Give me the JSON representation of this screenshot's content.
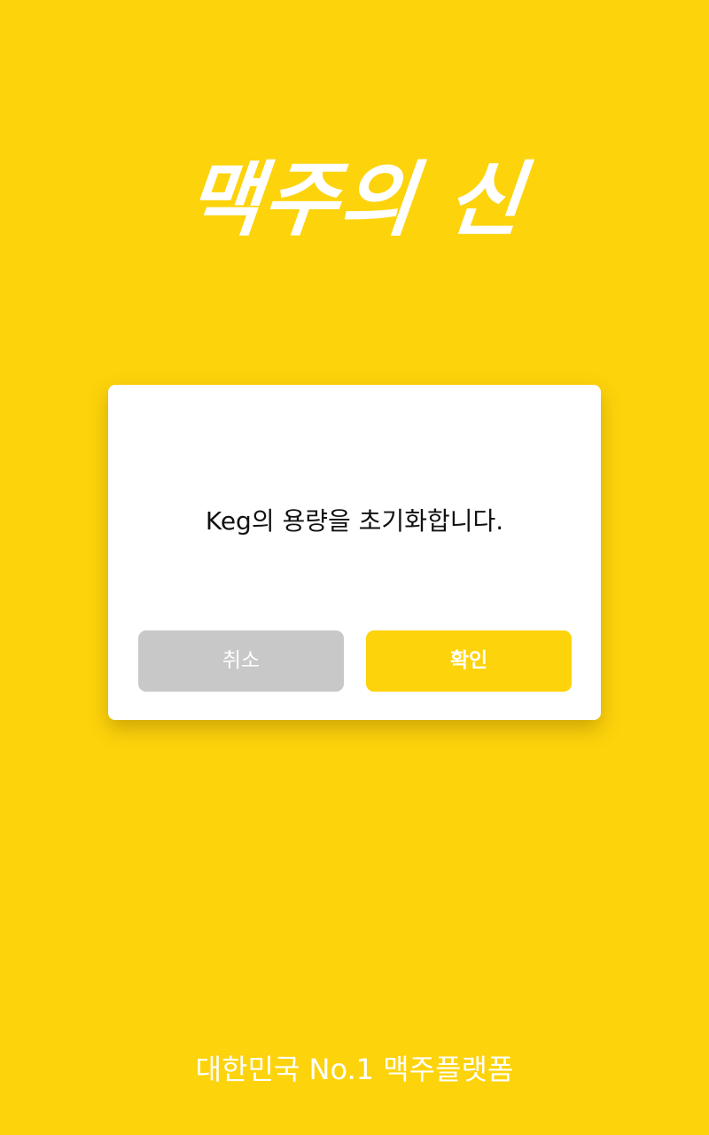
{
  "logo": {
    "text": "맥주의 신"
  },
  "dialog": {
    "message": "Keg의 용량을 초기화합니다.",
    "cancel_label": "취소",
    "confirm_label": "확인"
  },
  "footer": {
    "tagline": "대한민국 No.1 맥주플랫폼"
  },
  "colors": {
    "background": "#FDD30B",
    "dialog_background": "#FFFFFF",
    "cancel_button": "#C8C8C8",
    "confirm_button": "#FDD30B",
    "text_light": "#FFFFFF",
    "text_dark": "#111111"
  }
}
